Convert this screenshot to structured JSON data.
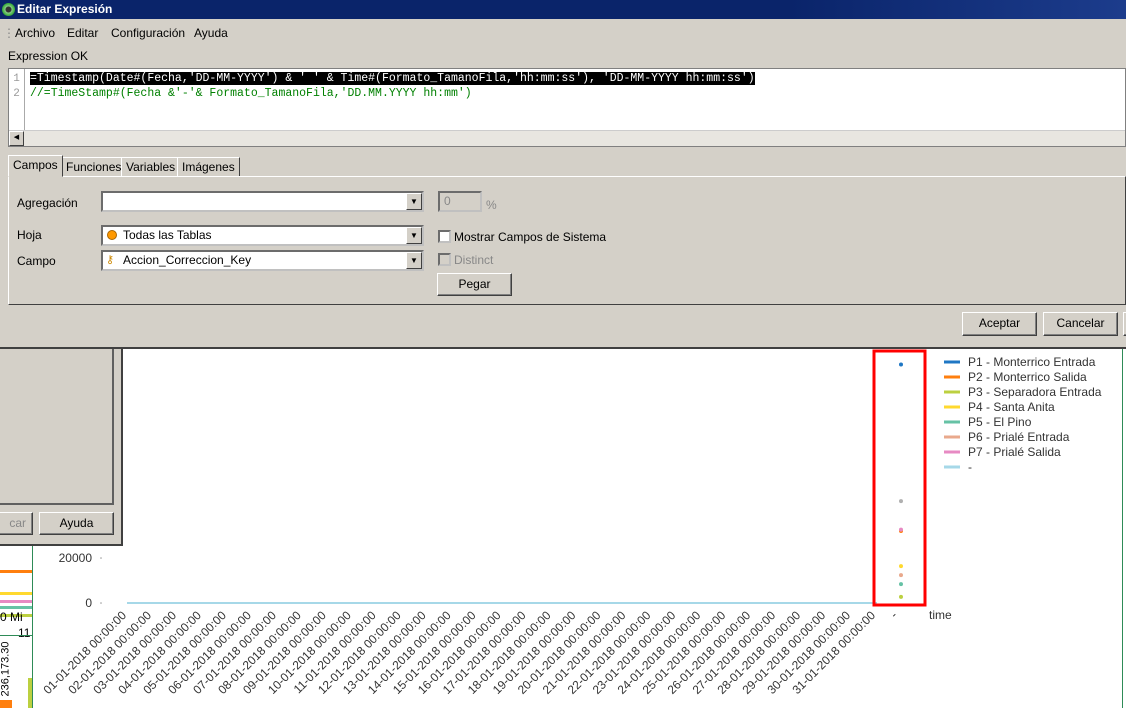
{
  "window": {
    "title": "Editar Expresión"
  },
  "menu": [
    "Archivo",
    "Editar",
    "Configuración",
    "Ayuda"
  ],
  "status": "Expression OK",
  "editor": {
    "line_numbers": [
      "1",
      "2"
    ],
    "lines": [
      "=Timestamp(Date#(Fecha,'DD-MM-YYYY') & ' ' & Time#(Formato_TamanoFila,'hh:mm:ss'), 'DD-MM-YYYY hh:mm:ss')",
      "//=TimeStamp#(Fecha &'-'& Formato_TamanoFila,'DD.MM.YYYY hh:mm')"
    ]
  },
  "tabs": [
    "Campos",
    "Funciones",
    "Variables",
    "Imágenes"
  ],
  "form": {
    "agregacion_label": "Agregación",
    "agregacion_value": "",
    "percent_value": "0",
    "percent_sign": "%",
    "hoja_label": "Hoja",
    "hoja_value": "Todas las Tablas",
    "campo_label": "Campo",
    "campo_value": "Accion_Correccion_Key",
    "mostrar_label": "Mostrar Campos de Sistema",
    "distinct_label": "Distinct",
    "pegar": "Pegar"
  },
  "buttons": {
    "aceptar": "Aceptar",
    "cancelar": "Cancelar"
  },
  "background_dialog": {
    "cancel_partial": "car",
    "ayuda": "Ayuda"
  },
  "background_chart": {
    "partial_label": "0 Mi",
    "partial_number": "11",
    "partial_vertical": "236,173.30"
  },
  "chart_data": {
    "type": "line",
    "x": [
      "01-01-2018 00:00:00",
      "02-01-2018 00:00:00",
      "03-01-2018 00:00:00",
      "04-01-2018 00:00:00",
      "05-01-2018 00:00:00",
      "06-01-2018 00:00:00",
      "07-01-2018 00:00:00",
      "08-01-2018 00:00:00",
      "09-01-2018 00:00:00",
      "10-01-2018 00:00:00",
      "11-01-2018 00:00:00",
      "12-01-2018 00:00:00",
      "13-01-2018 00:00:00",
      "14-01-2018 00:00:00",
      "15-01-2018 00:00:00",
      "16-01-2018 00:00:00",
      "17-01-2018 00:00:00",
      "18-01-2018 00:00:00",
      "19-01-2018 00:00:00",
      "20-01-2018 00:00:00",
      "21-01-2018 00:00:00",
      "22-01-2018 00:00:00",
      "23-01-2018 00:00:00",
      "24-01-2018 00:00:00",
      "25-01-2018 00:00:00",
      "26-01-2018 00:00:00",
      "27-01-2018 00:00:00",
      "28-01-2018 00:00:00",
      "29-01-2018 00:00:00",
      "30-01-2018 00:00:00",
      "31-01-2018 00:00:00",
      "-"
    ],
    "xlabel": "time",
    "yticks": [
      0,
      20000
    ],
    "series": [
      {
        "name": "P1 - Monterrico Entrada",
        "color": "#1f77c4",
        "point": 106000
      },
      {
        "name": "P2 - Monterrico Salida",
        "color": "#ff7f0e",
        "point": 32000
      },
      {
        "name": "P3 - Separadora Entrada",
        "color": "#bcd040",
        "point": 2700
      },
      {
        "name": "P4 - Santa Anita",
        "color": "#ffd92f",
        "point": 16400
      },
      {
        "name": "P5 - El Pino",
        "color": "#66c2a5",
        "point": 8400
      },
      {
        "name": "P6 - Prialé Entrada",
        "color": "#e9a98c",
        "point": 12400
      },
      {
        "name": "P7 - Prialé Salida",
        "color": "#e78ac3",
        "point": 32600
      },
      {
        "name": "-",
        "color": "#a6d8e8",
        "point": null
      }
    ],
    "extra_point": {
      "color": "#b0b0b0",
      "value": 45300
    },
    "highlight_color": "#ff0000"
  }
}
